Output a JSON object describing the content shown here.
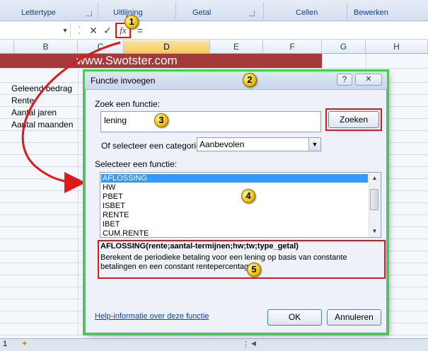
{
  "ribbon": {
    "groups": [
      "Lettertype",
      "Uitlijning",
      "Getal",
      "Cellen",
      "Bewerken"
    ]
  },
  "formula_bar": {
    "cancel_icon": "✕",
    "enter_icon": "✓",
    "fx_label": "fx",
    "equals": "="
  },
  "sheet": {
    "columns": [
      "B",
      "C",
      "D",
      "E",
      "F",
      "G",
      "H"
    ],
    "selected_column": "D",
    "banner": "www.Swotster.com",
    "cells": [
      "Geleend bedrag",
      "Rente",
      "Aantal jaren",
      "Aantal maanden"
    ],
    "tab_label": "1"
  },
  "dialog": {
    "title": "Functie invoegen",
    "help_btn": "?",
    "close_btn": "✕",
    "search_label": "Zoek een functie:",
    "search_value": "lening",
    "search_button": "Zoeken",
    "category_label": "Of selecteer een categorie:",
    "category_value": "Aanbevolen",
    "select_label": "Selecteer een functie:",
    "functions": [
      "AFLOSSING",
      "HW",
      "PBET",
      "ISBET",
      "RENTE",
      "IBET",
      "CUM.RENTE"
    ],
    "selected_function": "AFLOSSING",
    "syntax": "AFLOSSING(rente;aantal-termijnen;hw;tw;type_getal)",
    "description": "Berekent de periodieke betaling voor een lening op basis van constante betalingen en een constant rentepercentage.",
    "help_link": "Help-informatie over deze functie",
    "ok_button": "OK",
    "cancel_button": "Annuleren"
  },
  "annotations": {
    "badges": [
      "1",
      "2",
      "3",
      "4",
      "5"
    ]
  },
  "colors": {
    "banner": "#a63a3a",
    "highlight_red": "#e01818",
    "highlight_green": "#3fd43f",
    "badge": "#f2c200",
    "selection": "#3399ff"
  }
}
